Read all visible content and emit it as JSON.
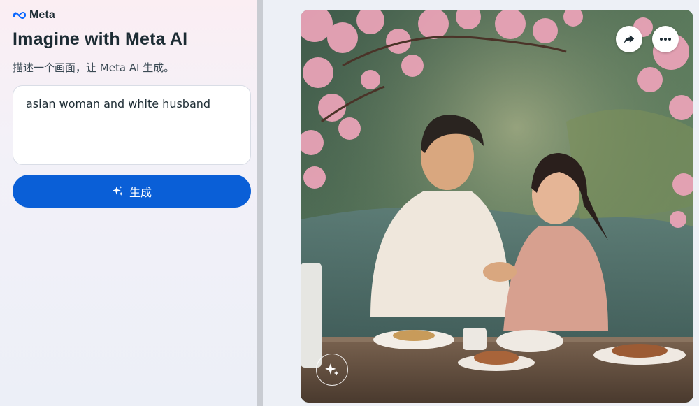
{
  "brand": {
    "name": "Meta",
    "logo_icon": "meta-infinity-logo"
  },
  "header": {
    "title": "Imagine with Meta AI",
    "subtitle": "描述一个画面，让 Meta AI 生成。"
  },
  "prompt": {
    "value": "asian woman and white husband"
  },
  "generate_button": {
    "label": "生成",
    "icon": "sparkle-icon",
    "color": "#0a5fd7"
  },
  "image_actions": [
    {
      "icon": "share-arrow-icon"
    },
    {
      "icon": "more-horizontal-icon"
    }
  ],
  "colors": {
    "accent": "#0a5fd7",
    "divider": "#c9ccd2"
  }
}
